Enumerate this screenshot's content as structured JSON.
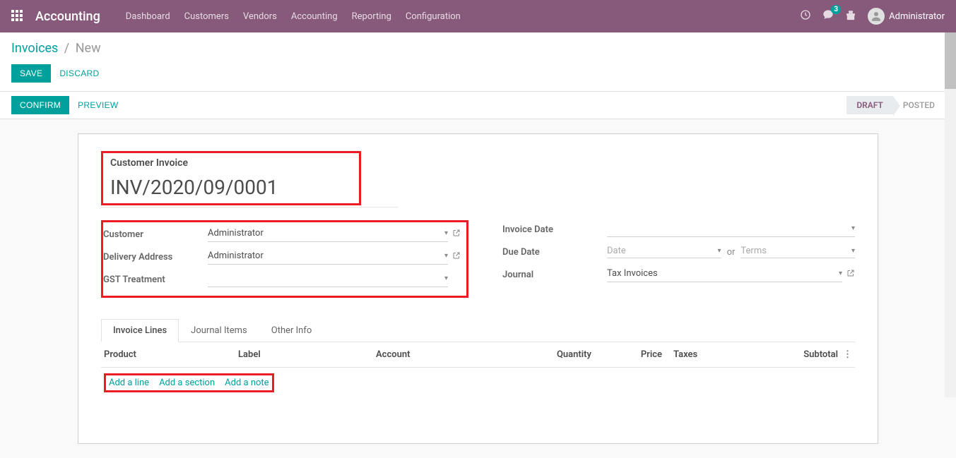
{
  "topbar": {
    "brand": "Accounting",
    "menu": [
      "Dashboard",
      "Customers",
      "Vendors",
      "Accounting",
      "Reporting",
      "Configuration"
    ],
    "msg_badge": "3",
    "user": "Administrator"
  },
  "breadcrumb": {
    "parent": "Invoices",
    "current": "New"
  },
  "buttons": {
    "save": "SAVE",
    "discard": "DISCARD",
    "confirm": "CONFIRM",
    "preview": "PREVIEW"
  },
  "status": {
    "draft": "DRAFT",
    "posted": "POSTED"
  },
  "form": {
    "title_label": "Customer Invoice",
    "title_value": "INV/2020/09/0001",
    "labels": {
      "customer": "Customer",
      "delivery_address": "Delivery Address",
      "gst_treatment": "GST Treatment",
      "invoice_date": "Invoice Date",
      "due_date": "Due Date",
      "journal": "Journal"
    },
    "values": {
      "customer": "Administrator",
      "delivery_address": "Administrator",
      "gst_treatment": "",
      "invoice_date": "",
      "due_date_placeholder": "Date",
      "terms_placeholder": "Terms",
      "journal": "Tax Invoices",
      "or": "or"
    }
  },
  "tabs": [
    "Invoice Lines",
    "Journal Items",
    "Other Info"
  ],
  "table": {
    "headers": {
      "product": "Product",
      "label": "Label",
      "account": "Account",
      "quantity": "Quantity",
      "price": "Price",
      "taxes": "Taxes",
      "subtotal": "Subtotal"
    },
    "add": {
      "line": "Add a line",
      "section": "Add a section",
      "note": "Add a note"
    }
  }
}
